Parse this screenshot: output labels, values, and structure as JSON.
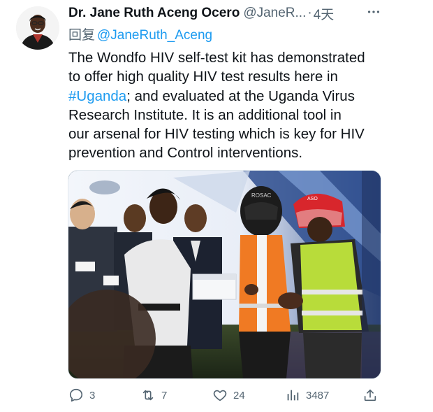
{
  "tweet": {
    "display_name": "Dr. Jane Ruth Aceng Ocero",
    "handle": "@JaneR...",
    "separator": "·",
    "time": "4天",
    "reply_prefix": "回复",
    "reply_mention": "@JaneRuth_Aceng",
    "text": {
      "line1": "The Wondfo HIV self-test kit has demonstrated",
      "line2": "to offer high quality HIV test results here in",
      "hashtag": "#Uganda",
      "line3_rest": "; and evaluated at the Uganda Virus",
      "line4": "Research Institute. It is  an additional tool in",
      "line5": "our arsenal for HIV testing which is key for HIV",
      "line6": "prevention and Control interventions."
    }
  },
  "media": {
    "helmet_text_left": "ROSAC",
    "helmet_text_right": "ASO"
  },
  "actions": {
    "replies": "3",
    "retweets": "7",
    "likes": "24",
    "views": "3487"
  },
  "colors": {
    "text": "#0f1419",
    "secondary": "#536471",
    "link": "#1d9bf0",
    "vest_orange": "#f07a23",
    "vest_green": "#b8dc3a",
    "helmet_red": "#d8262c"
  },
  "icons": [
    "more-icon",
    "reply-icon",
    "retweet-icon",
    "like-icon",
    "views-icon",
    "share-icon"
  ]
}
